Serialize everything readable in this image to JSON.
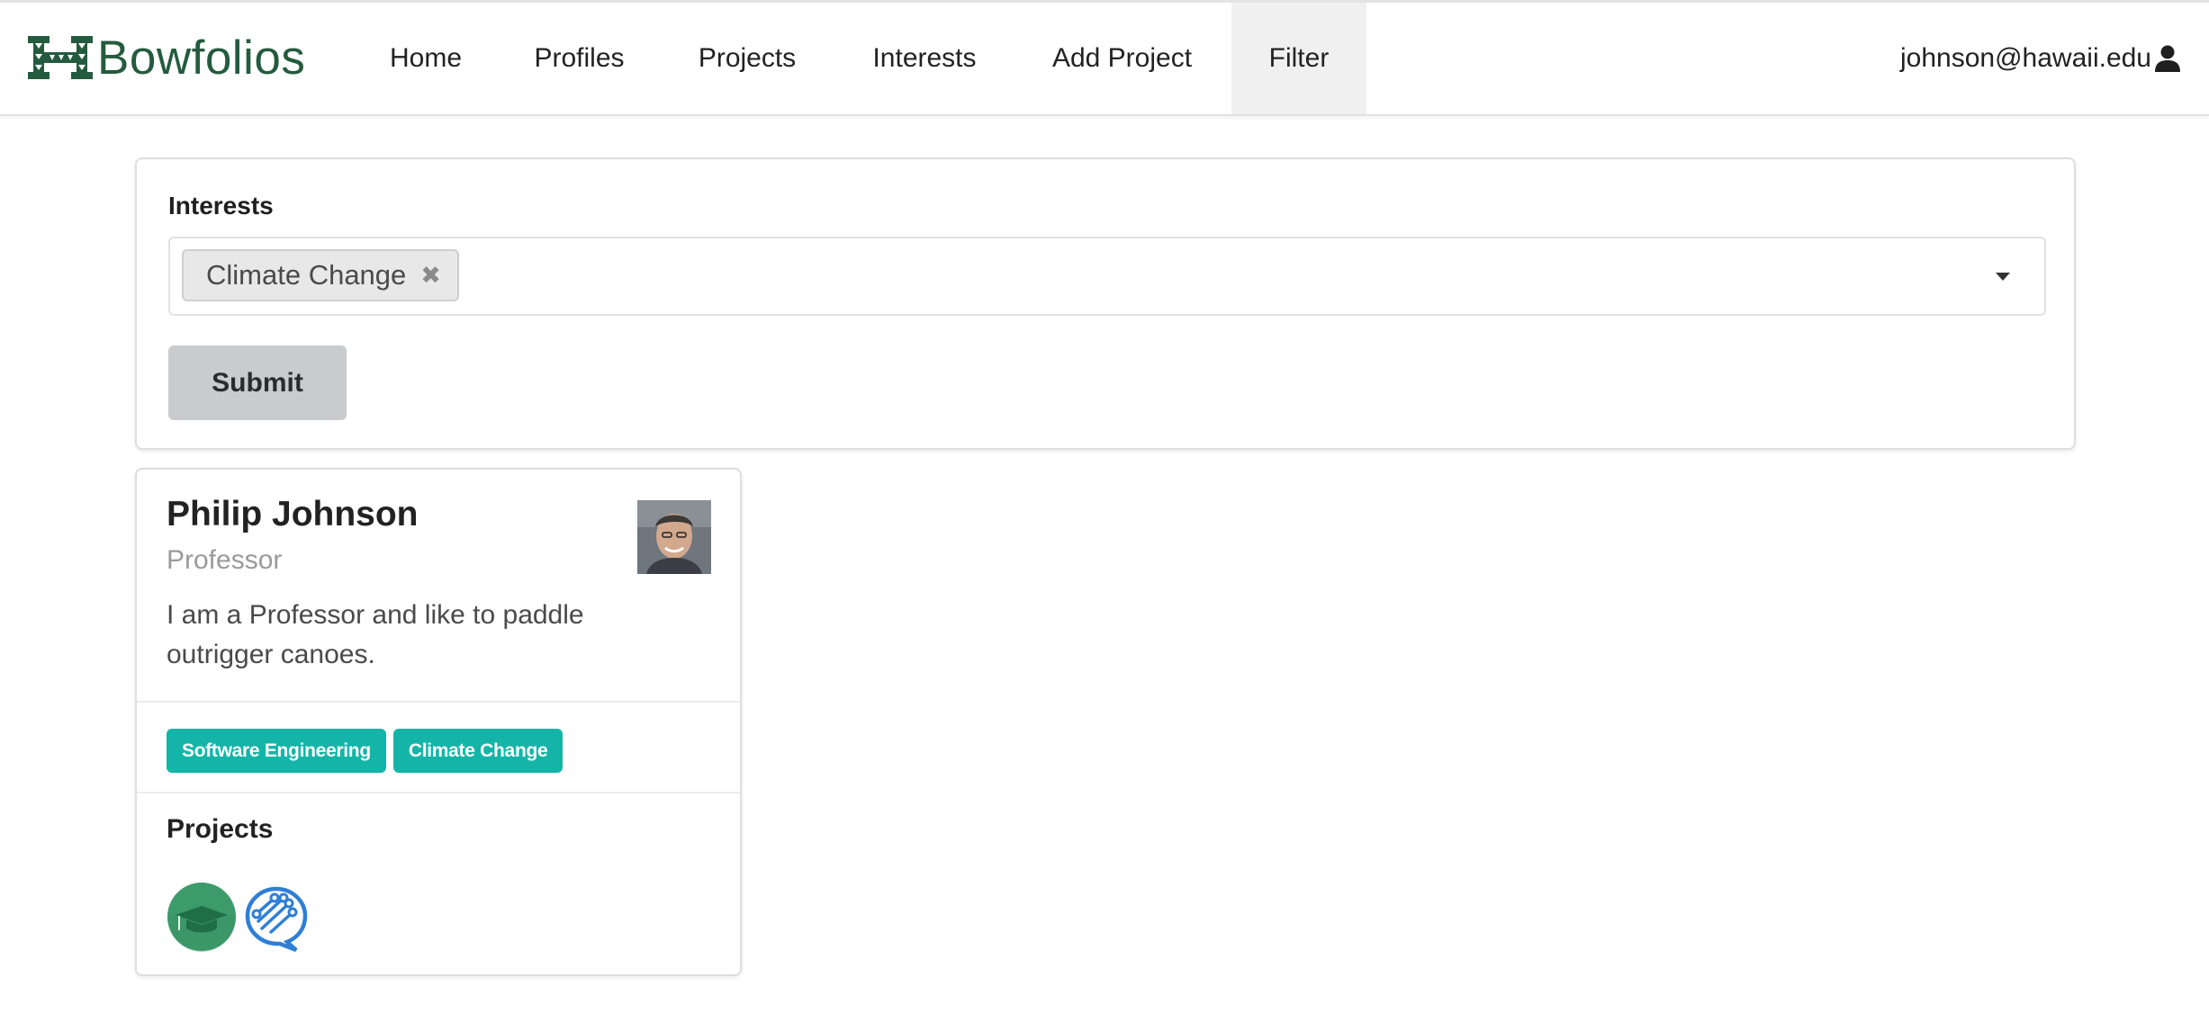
{
  "app": {
    "brand_name": "Bowfolios",
    "brand_color": "#245b3e",
    "accent_color": "#14b5a8"
  },
  "nav": {
    "items": [
      {
        "label": "Home",
        "active": false
      },
      {
        "label": "Profiles",
        "active": false
      },
      {
        "label": "Projects",
        "active": false
      },
      {
        "label": "Interests",
        "active": false
      },
      {
        "label": "Add Project",
        "active": false
      },
      {
        "label": "Filter",
        "active": true
      }
    ],
    "user_email": "johnson@hawaii.edu",
    "user_icon": "user-icon"
  },
  "filter_form": {
    "field_label": "Interests",
    "selected": [
      {
        "label": "Climate Change",
        "remove_glyph": "✖"
      }
    ],
    "submit_label": "Submit"
  },
  "profile": {
    "name": "Philip Johnson",
    "title": "Professor",
    "bio": "I am a Professor and like to paddle outrigger canoes.",
    "interests": [
      "Software Engineering",
      "Climate Change"
    ],
    "projects_heading": "Projects",
    "project_icons": [
      "graduation-cap-project-icon",
      "circuit-chat-project-icon"
    ]
  }
}
